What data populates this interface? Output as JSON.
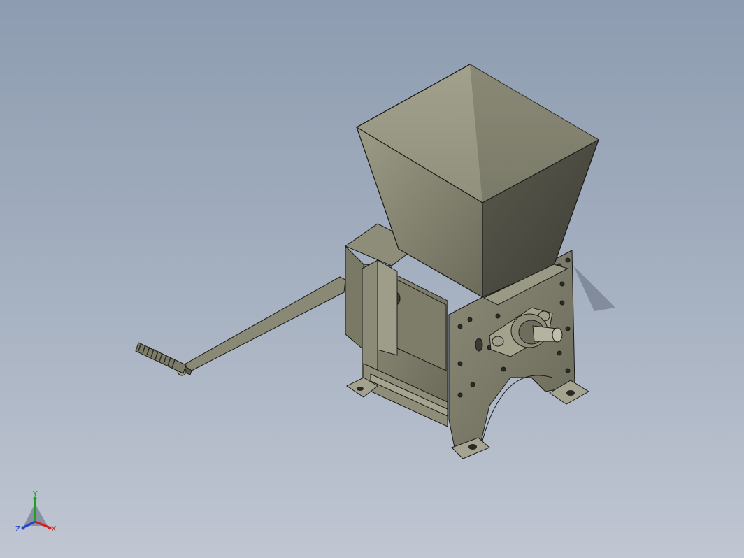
{
  "viewport": {
    "background_top": "#8d9cb0",
    "background_bottom": "#c0c6d2"
  },
  "model": {
    "body_color": "#7b7a68",
    "edge_color": "#1a1a1a",
    "shade_color": "#55554a",
    "light_color": "#b1b09c"
  },
  "triad": {
    "x_label": "X",
    "y_label": "Y",
    "z_label": "Z",
    "x_color": "#d02020",
    "y_color": "#20a020",
    "z_color": "#2040d0"
  }
}
